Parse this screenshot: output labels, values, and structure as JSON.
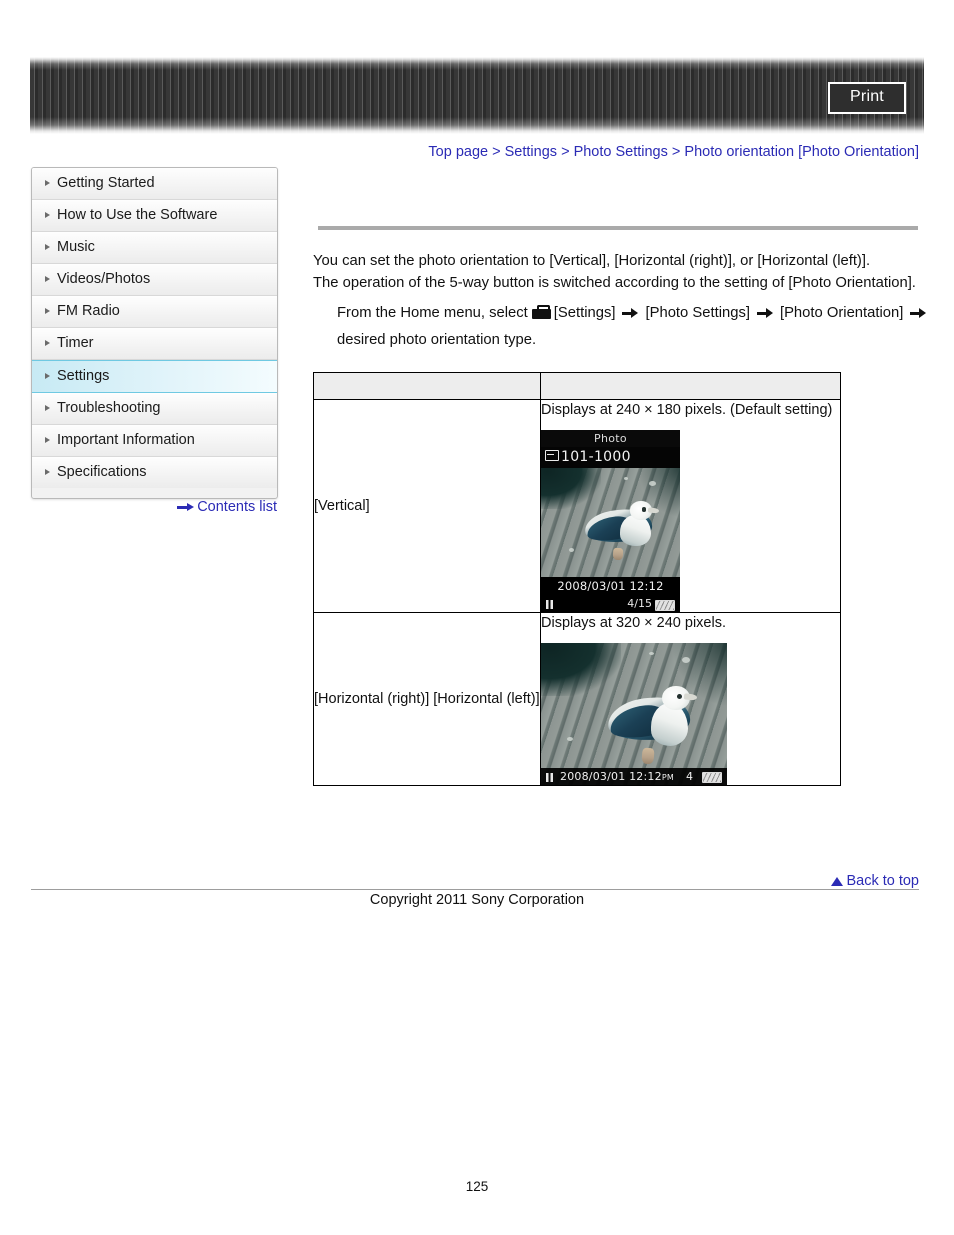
{
  "banner": {
    "print_label": "Print"
  },
  "breadcrumb": {
    "items": [
      "Top page",
      "Settings",
      "Photo Settings",
      "Photo orientation [Photo Orientation]"
    ],
    "separator": ">",
    "full_text": "Top page > Settings > Photo Settings > Photo orientation [Photo Orientation]",
    "link_color": "#2b2bb5"
  },
  "sidebar": {
    "items": [
      {
        "label": "Getting Started",
        "active": false
      },
      {
        "label": "How to Use the Software",
        "active": false
      },
      {
        "label": "Music",
        "active": false
      },
      {
        "label": "Videos/Photos",
        "active": false
      },
      {
        "label": "FM Radio",
        "active": false
      },
      {
        "label": "Timer",
        "active": false
      },
      {
        "label": "Settings",
        "active": true
      },
      {
        "label": "Troubleshooting",
        "active": false
      },
      {
        "label": "Important Information",
        "active": false
      },
      {
        "label": "Specifications",
        "active": false
      }
    ],
    "active_color": "#6fc9e2",
    "contents_link": "Contents list"
  },
  "main": {
    "intro_line_1": "You can set the photo orientation to [Vertical], [Horizontal (right)], or [Horizontal (left)].",
    "intro_line_2": "The operation of the 5-way button is switched according to the setting of [Photo Orientation].",
    "step_prefix": "From the Home menu, select",
    "step_item_1": "[Settings]",
    "step_item_2": "[Photo Settings]",
    "step_item_3": "[Photo Orientation]",
    "step_tail": "desired photo orientation type."
  },
  "table": {
    "header": {
      "col1": "",
      "col2": ""
    },
    "rows": [
      {
        "label": "[Vertical]",
        "description": "Displays at 240 × 180 pixels. (Default setting)",
        "screen": {
          "orientation": "vertical",
          "title": "Photo",
          "file_number": "101-1000",
          "date": "2008/03/01 12:12",
          "count": "4/15"
        }
      },
      {
        "label": "[Horizontal (right)] [Horizontal (left)]",
        "description": "Displays at 320 × 240 pixels.",
        "screen": {
          "orientation": "horizontal",
          "date": "2008/03/01 12:12",
          "ampm": "PM",
          "count": "4"
        }
      }
    ]
  },
  "footer": {
    "back_to_top": "Back to top",
    "copyright": "Copyright 2011 Sony Corporation",
    "page_number": "125"
  }
}
